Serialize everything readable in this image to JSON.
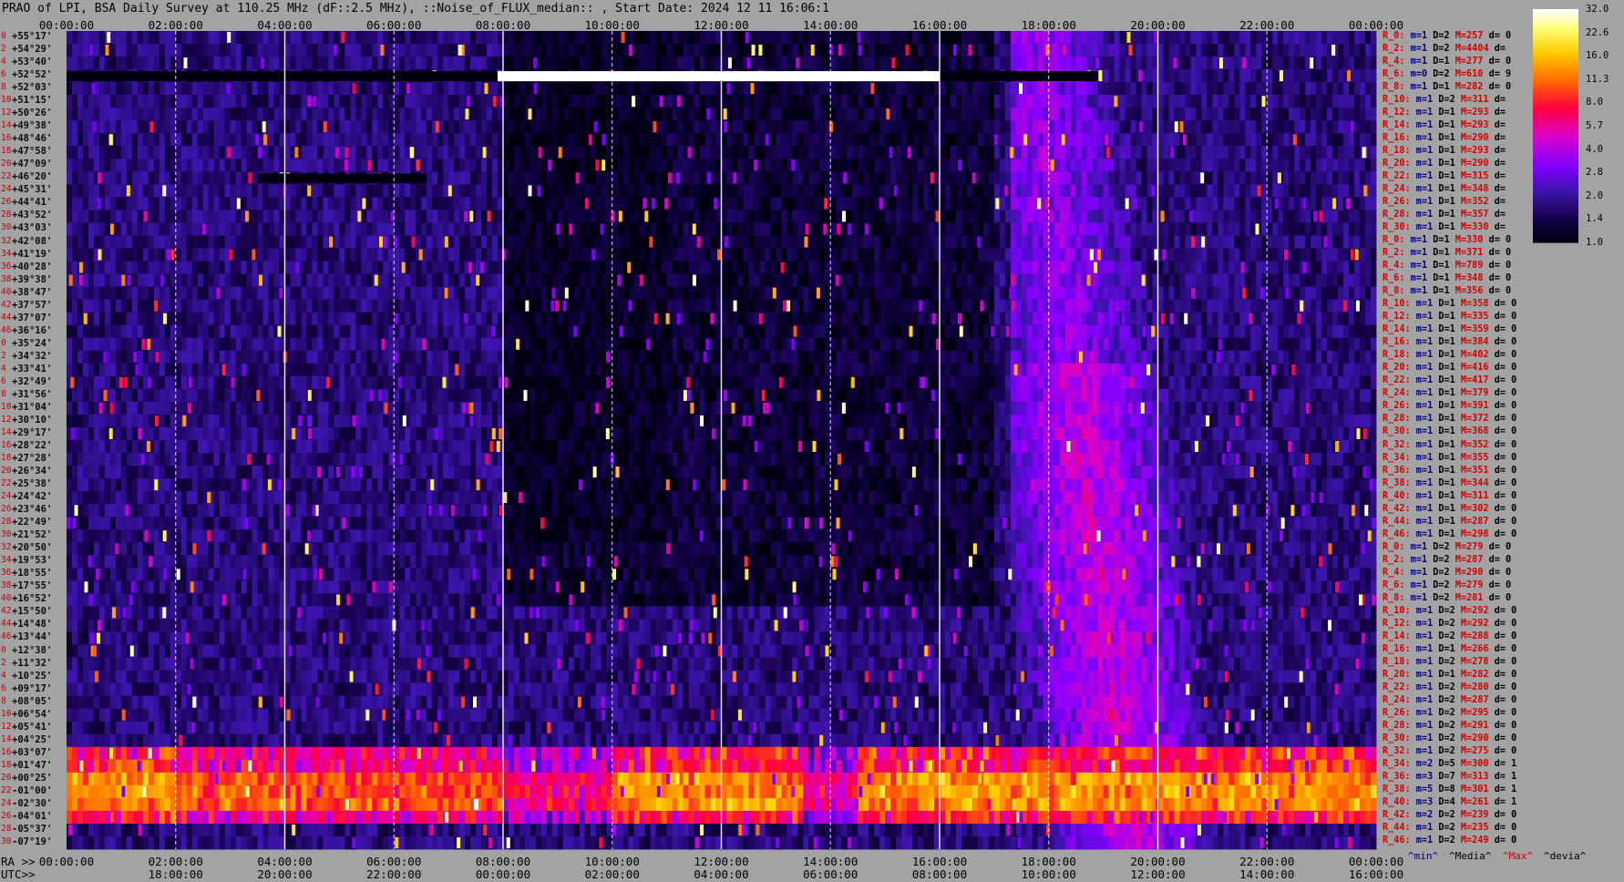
{
  "title": "PRAO of LPI, BSA Daily Survey at 110.25 MHz (dF::2.5 MHz), ::Noise_of_FLUX_median:: , Start Date: 2024 12 11 16:06:1",
  "chart_data": {
    "type": "heatmap",
    "title": "PRAO of LPI, BSA Daily Survey at 110.25 MHz (dF::2.5 MHz), ::Noise_of_FLUX_median:: , Start Date: 2024 12 11 16:06:1",
    "x_top_ticks": [
      "00:00:00",
      "02:00:00",
      "04:00:00",
      "06:00:00",
      "08:00:00",
      "10:00:00",
      "12:00:00",
      "14:00:00",
      "16:00:00",
      "18:00:00",
      "20:00:00",
      "22:00:00",
      "00:00:00"
    ],
    "x_bottom_ra_label": "RA >>",
    "x_bottom_ra_ticks": [
      "00:00:00",
      "02:00:00",
      "04:00:00",
      "06:00:00",
      "08:00:00",
      "10:00:00",
      "12:00:00",
      "14:00:00",
      "16:00:00",
      "18:00:00",
      "20:00:00",
      "22:00:00",
      "00:00:00"
    ],
    "x_bottom_utc_label": "UTC>>",
    "x_bottom_utc_ticks": [
      "",
      "18:00:00",
      "20:00:00",
      "22:00:00",
      "00:00:00",
      "02:00:00",
      "04:00:00",
      "06:00:00",
      "08:00:00",
      "10:00:00",
      "12:00:00",
      "14:00:00",
      "16:00:00"
    ],
    "row_index": [
      "0",
      "2",
      "4",
      "6",
      "8",
      "10",
      "12",
      "14",
      "16",
      "18",
      "20",
      "22",
      "24",
      "26",
      "28",
      "30",
      "32",
      "34",
      "36",
      "38",
      "40",
      "42",
      "44",
      "46",
      "0",
      "2",
      "4",
      "6",
      "8",
      "10",
      "12",
      "14",
      "16",
      "18",
      "20",
      "22",
      "24",
      "26",
      "28",
      "30",
      "32",
      "34",
      "36",
      "38",
      "40",
      "42",
      "44",
      "46",
      "0",
      "2",
      "4",
      "6",
      "8",
      "10",
      "12",
      "14",
      "16",
      "18",
      "20",
      "22",
      "24",
      "26",
      "28",
      "30",
      "32",
      "34",
      "36",
      "38",
      "40",
      "42",
      "44",
      "46"
    ],
    "declinations": [
      "+55°17'",
      "+54°29'",
      "+53°40'",
      "+52°52'",
      "+52°03'",
      "+51°15'",
      "+50°26'",
      "+49°38'",
      "+48°46'",
      "+47°58'",
      "+47°09'",
      "+46°20'",
      "+45°31'",
      "+44°41'",
      "+43°52'",
      "+43°03'",
      "+42°08'",
      "+41°19'",
      "+40°28'",
      "+39°38'",
      "+38°47'",
      "+37°57'",
      "+37°07'",
      "+36°16'",
      "+35°24'",
      "+34°32'",
      "+33°41'",
      "+32°49'",
      "+31°56'",
      "+31°04'",
      "+30°10'",
      "+29°17'",
      "+28°22'",
      "+27°28'",
      "+26°34'",
      "+25°38'",
      "+24°42'",
      "+23°46'",
      "+22°49'",
      "+21°52'",
      "+20°50'",
      "+19°53'",
      "+18°55'",
      "+17°55'",
      "+16°52'",
      "+15°50'",
      "+14°48'",
      "+13°44'",
      "+12°38'",
      "+11°32'",
      "+10°25'",
      "+09°17'",
      "+08°05'",
      "+06°54'",
      "+05°41'",
      "+04°25'",
      "+03°07'",
      "+01°47'",
      "+00°25'",
      "-01°00'",
      "-02°30'",
      "-04°01'",
      "-05°37'",
      "-07°19'"
    ],
    "stats": [
      [
        "R_0:",
        "m=1",
        "D=2",
        "M=257",
        "d= 0"
      ],
      [
        "R_2:",
        "m=1",
        "D=2",
        "M=4404",
        "d="
      ],
      [
        "R_4:",
        "m=1",
        "D=1",
        "M=277",
        "d= 0"
      ],
      [
        "R_6:",
        "m=0",
        "D=2",
        "M=610",
        "d= 9"
      ],
      [
        "R_8:",
        "m=1",
        "D=1",
        "M=282",
        "d= 0"
      ],
      [
        "R_10:",
        "m=1",
        "D=2",
        "M=311",
        "d="
      ],
      [
        "R_12:",
        "m=1",
        "D=1",
        "M=293",
        "d="
      ],
      [
        "R_14:",
        "m=1",
        "D=1",
        "M=293",
        "d="
      ],
      [
        "R_16:",
        "m=1",
        "D=1",
        "M=290",
        "d="
      ],
      [
        "R_18:",
        "m=1",
        "D=1",
        "M=293",
        "d="
      ],
      [
        "R_20:",
        "m=1",
        "D=1",
        "M=290",
        "d="
      ],
      [
        "R_22:",
        "m=1",
        "D=1",
        "M=315",
        "d="
      ],
      [
        "R_24:",
        "m=1",
        "D=1",
        "M=348",
        "d="
      ],
      [
        "R_26:",
        "m=1",
        "D=1",
        "M=352",
        "d="
      ],
      [
        "R_28:",
        "m=1",
        "D=1",
        "M=357",
        "d="
      ],
      [
        "R_30:",
        "m=1",
        "D=1",
        "M=330",
        "d="
      ],
      [
        "R_0:",
        "m=1",
        "D=1",
        "M=330",
        "d= 0"
      ],
      [
        "R_2:",
        "m=1",
        "D=1",
        "M=371",
        "d= 0"
      ],
      [
        "R_4:",
        "m=1",
        "D=1",
        "M=789",
        "d= 0"
      ],
      [
        "R_6:",
        "m=1",
        "D=1",
        "M=348",
        "d= 0"
      ],
      [
        "R_8:",
        "m=1",
        "D=1",
        "M=356",
        "d= 0"
      ],
      [
        "R_10:",
        "m=1",
        "D=1",
        "M=358",
        "d= 0"
      ],
      [
        "R_12:",
        "m=1",
        "D=1",
        "M=335",
        "d= 0"
      ],
      [
        "R_14:",
        "m=1",
        "D=1",
        "M=359",
        "d= 0"
      ],
      [
        "R_16:",
        "m=1",
        "D=1",
        "M=384",
        "d= 0"
      ],
      [
        "R_18:",
        "m=1",
        "D=1",
        "M=402",
        "d= 0"
      ],
      [
        "R_20:",
        "m=1",
        "D=1",
        "M=416",
        "d= 0"
      ],
      [
        "R_22:",
        "m=1",
        "D=1",
        "M=417",
        "d= 0"
      ],
      [
        "R_24:",
        "m=1",
        "D=1",
        "M=379",
        "d= 0"
      ],
      [
        "R_26:",
        "m=1",
        "D=1",
        "M=391",
        "d= 0"
      ],
      [
        "R_28:",
        "m=1",
        "D=1",
        "M=372",
        "d= 0"
      ],
      [
        "R_30:",
        "m=1",
        "D=1",
        "M=368",
        "d= 0"
      ],
      [
        "R_32:",
        "m=1",
        "D=1",
        "M=352",
        "d= 0"
      ],
      [
        "R_34:",
        "m=1",
        "D=1",
        "M=355",
        "d= 0"
      ],
      [
        "R_36:",
        "m=1",
        "D=1",
        "M=351",
        "d= 0"
      ],
      [
        "R_38:",
        "m=1",
        "D=1",
        "M=344",
        "d= 0"
      ],
      [
        "R_40:",
        "m=1",
        "D=1",
        "M=311",
        "d= 0"
      ],
      [
        "R_42:",
        "m=1",
        "D=1",
        "M=302",
        "d= 0"
      ],
      [
        "R_44:",
        "m=1",
        "D=1",
        "M=287",
        "d= 0"
      ],
      [
        "R_46:",
        "m=1",
        "D=1",
        "M=298",
        "d= 0"
      ],
      [
        "R_0:",
        "m=1",
        "D=2",
        "M=279",
        "d= 0"
      ],
      [
        "R_2:",
        "m=1",
        "D=2",
        "M=287",
        "d= 0"
      ],
      [
        "R_4:",
        "m=1",
        "D=2",
        "M=290",
        "d= 0"
      ],
      [
        "R_6:",
        "m=1",
        "D=2",
        "M=279",
        "d= 0"
      ],
      [
        "R_8:",
        "m=1",
        "D=2",
        "M=281",
        "d= 0"
      ],
      [
        "R_10:",
        "m=1",
        "D=2",
        "M=292",
        "d= 0"
      ],
      [
        "R_12:",
        "m=1",
        "D=2",
        "M=292",
        "d= 0"
      ],
      [
        "R_14:",
        "m=1",
        "D=2",
        "M=288",
        "d= 0"
      ],
      [
        "R_16:",
        "m=1",
        "D=1",
        "M=266",
        "d= 0"
      ],
      [
        "R_18:",
        "m=1",
        "D=2",
        "M=278",
        "d= 0"
      ],
      [
        "R_20:",
        "m=1",
        "D=1",
        "M=282",
        "d= 0"
      ],
      [
        "R_22:",
        "m=1",
        "D=2",
        "M=280",
        "d= 0"
      ],
      [
        "R_24:",
        "m=1",
        "D=2",
        "M=287",
        "d= 0"
      ],
      [
        "R_26:",
        "m=1",
        "D=2",
        "M=295",
        "d= 0"
      ],
      [
        "R_28:",
        "m=1",
        "D=2",
        "M=291",
        "d= 0"
      ],
      [
        "R_30:",
        "m=1",
        "D=2",
        "M=290",
        "d= 0"
      ],
      [
        "R_32:",
        "m=1",
        "D=2",
        "M=275",
        "d= 0"
      ],
      [
        "R_34:",
        "m=2",
        "D=5",
        "M=300",
        "d= 1"
      ],
      [
        "R_36:",
        "m=3",
        "D=7",
        "M=313",
        "d= 1"
      ],
      [
        "R_38:",
        "m=5",
        "D=8",
        "M=301",
        "d= 1"
      ],
      [
        "R_40:",
        "m=3",
        "D=4",
        "M=261",
        "d= 1"
      ],
      [
        "R_42:",
        "m=2",
        "D=2",
        "M=239",
        "d= 0"
      ],
      [
        "R_44:",
        "m=1",
        "D=2",
        "M=235",
        "d= 0"
      ],
      [
        "R_46:",
        "m=1",
        "D=2",
        "M=249",
        "d= 0"
      ]
    ],
    "colorbar": {
      "ticks": [
        "32.0",
        "22.6",
        "16.0",
        "11.3",
        "8.0",
        "5.7",
        "4.0",
        "2.8",
        "2.0",
        "1.4",
        "1.0"
      ],
      "colors": [
        "#ffffff",
        "#ffff80",
        "#ffd000",
        "#ff8000",
        "#ff2000",
        "#ff00a0",
        "#a000ff",
        "#4a10c0",
        "#100040",
        "#000010"
      ],
      "scale": "log2"
    },
    "legend": [
      {
        "text": "^min^",
        "color": "#000080"
      },
      {
        "text": "^Media^",
        "color": "#000000"
      },
      {
        "text": "^Max^",
        "color": "#d00000"
      },
      {
        "text": "^devia^",
        "color": "#000000"
      }
    ],
    "grid_solid_hours": [
      4,
      8,
      12,
      16,
      20
    ],
    "grid_dashed_hours": [
      2,
      6,
      10,
      14,
      18,
      22
    ],
    "features": [
      {
        "name": "saturated strip",
        "row": 3,
        "ra_start": 7.9,
        "ra_end": 16.0,
        "value": 32
      },
      {
        "name": "dark strip",
        "row": 3,
        "ra_start": 0.0,
        "ra_end": 18.9,
        "value": 1.0
      },
      {
        "name": "dark strip",
        "row": 11,
        "ra_start": 3.5,
        "ra_end": 6.6,
        "value": 1.0
      },
      {
        "name": "galactic plane band",
        "row_start": 56,
        "row_end": 61,
        "value": 11
      },
      {
        "name": "galactic ridge",
        "ra_start": 17.5,
        "ra_end": 21.0,
        "value": 4
      }
    ]
  }
}
